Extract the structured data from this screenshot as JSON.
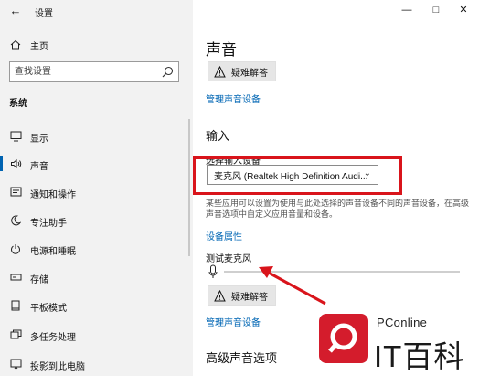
{
  "window": {
    "back_icon": "arrow-left-icon",
    "title": "设置",
    "controls": [
      "minimize-icon",
      "maximize-icon",
      "close-icon"
    ]
  },
  "sidebar": {
    "home": {
      "label": "主页",
      "icon": "home-icon"
    },
    "search": {
      "placeholder": "查找设置",
      "icon": "search-icon"
    },
    "section": "系统",
    "items": [
      {
        "label": "显示",
        "icon": "display-icon",
        "active": false
      },
      {
        "label": "声音",
        "icon": "speaker-icon",
        "active": true
      },
      {
        "label": "通知和操作",
        "icon": "notification-icon",
        "active": false
      },
      {
        "label": "专注助手",
        "icon": "moon-icon",
        "active": false
      },
      {
        "label": "电源和睡眠",
        "icon": "power-icon",
        "active": false
      },
      {
        "label": "存储",
        "icon": "storage-icon",
        "active": false
      },
      {
        "label": "平板模式",
        "icon": "tablet-icon",
        "active": false
      },
      {
        "label": "多任务处理",
        "icon": "multitask-icon",
        "active": false
      },
      {
        "label": "投影到此电脑",
        "icon": "project-icon",
        "active": false
      }
    ]
  },
  "main": {
    "title": "声音",
    "troubleshoot_top": "疑难解答",
    "manage_devices_top": "管理声音设备",
    "input": {
      "heading": "输入",
      "choose_label": "选择输入设备",
      "selected_device": "麦克风 (Realtek High Definition Audi...",
      "description": "某些应用可以设置为使用与此处选择的声音设备不同的声音设备，在高级声音选项中自定义应用音量和设备。",
      "device_properties": "设备属性",
      "test_mic_label": "测试麦克风",
      "mic_level": 0,
      "troubleshoot": "疑难解答",
      "manage_devices": "管理声音设备"
    },
    "advanced_heading": "高级声音选项"
  },
  "colors": {
    "accent": "#0063b1",
    "link": "#0066b4",
    "annotation_red": "#d9141b",
    "sidebar_bg": "#f2f2f2"
  },
  "watermark": {
    "brand": "PConline",
    "text": "IT百科"
  }
}
